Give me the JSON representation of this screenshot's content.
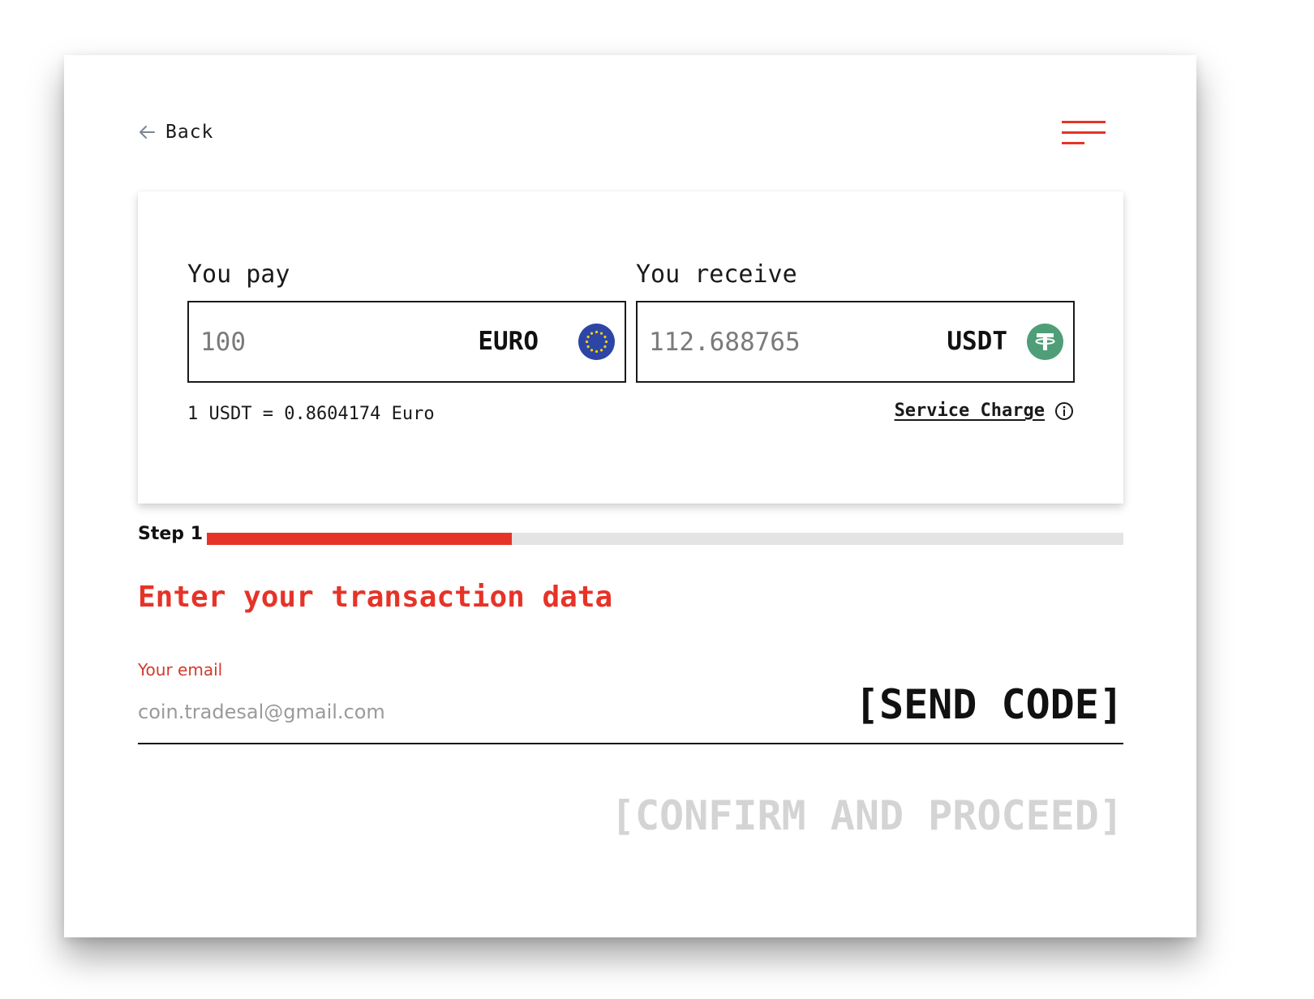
{
  "header": {
    "back_label": "Back",
    "back_icon": "arrow-left-icon",
    "menu_icon": "hamburger-menu-icon"
  },
  "converter": {
    "pay": {
      "label": "You pay",
      "amount": "100",
      "currency": "EURO",
      "icon": "eu-flag-icon"
    },
    "receive": {
      "label": "You receive",
      "amount": "112.688765",
      "currency": "USDT",
      "icon": "tether-icon"
    },
    "rate_text": "1 USDT = 0.8604174 Euro",
    "service_charge_label": "Service Charge",
    "service_charge_icon": "info-icon"
  },
  "progress": {
    "step_label": "Step 1",
    "fraction": 0.333
  },
  "form": {
    "title": "Enter your transaction data",
    "email_label": "Your email",
    "email_placeholder": "coin.tradesal@gmail.com",
    "send_code_label": "[SEND CODE]",
    "confirm_label": "[CONFIRM AND PROCEED]"
  },
  "colors": {
    "accent": "#e63328",
    "eu_blue": "#2d46a6",
    "tether_green": "#4f9e78",
    "disabled_text": "#d4d4d4"
  }
}
